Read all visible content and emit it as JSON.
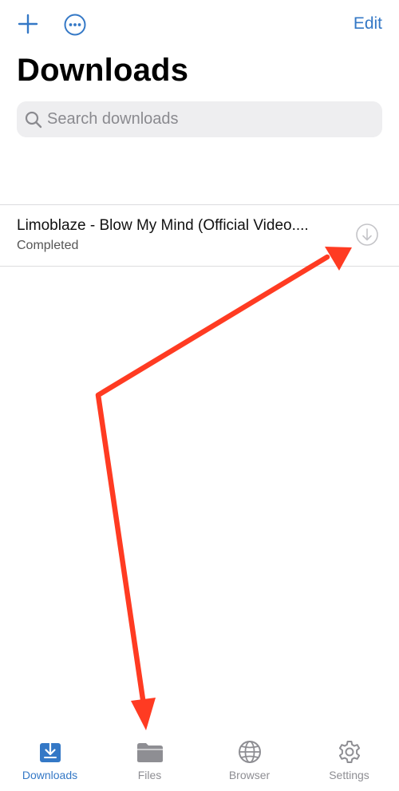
{
  "header": {
    "title": "Downloads",
    "edit_label": "Edit",
    "left_icons": [
      "plus-icon",
      "more-icon"
    ]
  },
  "search": {
    "placeholder": "Search downloads",
    "value": ""
  },
  "downloads": [
    {
      "title": "Limoblaze - Blow My Mind (Official Video....",
      "status": "Completed",
      "icon": "download-circle-icon"
    }
  ],
  "tabs": [
    {
      "label": "Downloads",
      "icon": "download-tray-icon",
      "active": true
    },
    {
      "label": "Files",
      "icon": "folder-icon",
      "active": false
    },
    {
      "label": "Browser",
      "icon": "globe-icon",
      "active": false
    },
    {
      "label": "Settings",
      "icon": "gear-icon",
      "active": false
    }
  ],
  "colors": {
    "accent": "#3478c6",
    "inactive": "#8e8e93",
    "annotation": "#ff3b22",
    "search_bg": "#eeeef0"
  }
}
